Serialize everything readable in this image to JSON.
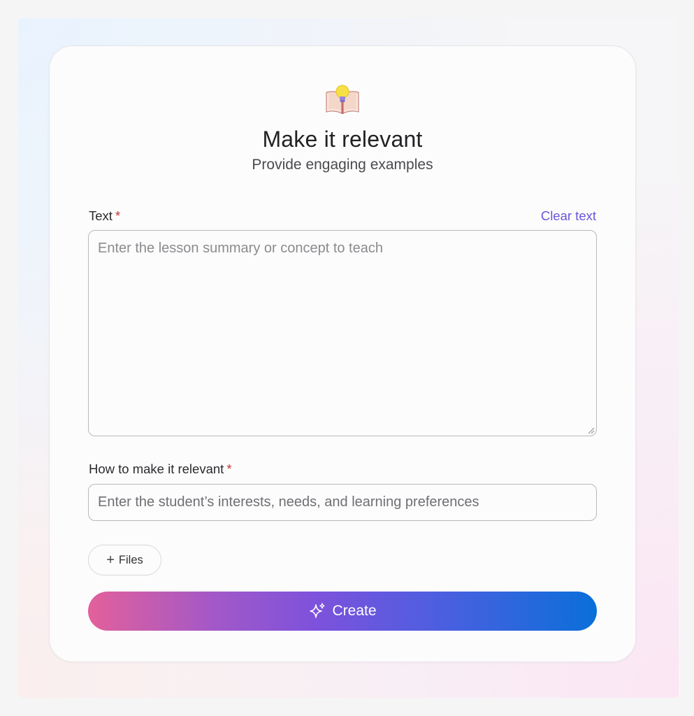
{
  "header": {
    "icon": "lightbulb-book-icon",
    "title": "Make it relevant",
    "subtitle": "Provide engaging examples"
  },
  "form": {
    "text_field": {
      "label": "Text",
      "required_mark": "*",
      "clear_label": "Clear text",
      "value": "",
      "placeholder": "Enter the lesson summary or concept to teach"
    },
    "relevance_field": {
      "label": "How to make it relevant",
      "required_mark": "*",
      "value": "",
      "placeholder": "Enter the student’s interests, needs, and learning preferences"
    },
    "files_button": {
      "icon": "plus-icon",
      "label": "Files"
    },
    "create_button": {
      "icon": "sparkle-icon",
      "label": "Create"
    }
  },
  "colors": {
    "accent_link": "#6b56d6",
    "required": "#c9333b",
    "button_gradient_start": "#e3609b",
    "button_gradient_mid": "#7d52dc",
    "button_gradient_end": "#0a6fd9"
  }
}
